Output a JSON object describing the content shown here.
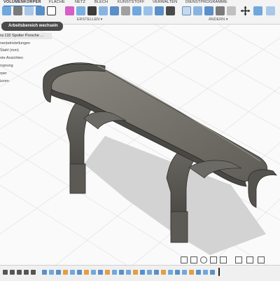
{
  "toolbar": {
    "tabs": [
      {
        "label": "VOLUMENKÖRPER"
      },
      {
        "label": "FLÄCHE"
      },
      {
        "label": "NETZ"
      },
      {
        "label": "BLECH"
      },
      {
        "label": "KUNSTSTOFF"
      },
      {
        "label": "VERWALTEN"
      },
      {
        "label": "DIENSTPROGRAMME"
      }
    ],
    "groups": {
      "create": "ERSTELLEN ▾",
      "modify": "ÄNDERN ▾"
    }
  },
  "workspace_switch": {
    "label": "Arbeitsbereich wechseln"
  },
  "browser": {
    "title": "ra 132 Spoiler Porsche ...",
    "items": [
      {
        "label": "nenteinstellungen"
      },
      {
        "label": "Stahl (mm)"
      },
      {
        "label": "nte Ansichten"
      },
      {
        "label": "rsprung"
      },
      {
        "label": "rper"
      },
      {
        "label": "izzen"
      }
    ]
  },
  "colors": {
    "accent": "#1a73c7",
    "model": "#75736c",
    "model_dark": "#3a3935",
    "grid": "#dcdcdc"
  }
}
